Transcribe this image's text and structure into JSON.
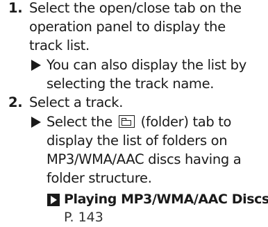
{
  "steps": [
    {
      "number": "1.",
      "lines": [
        "Select the open/close tab on the",
        "operation panel to display the",
        "track list."
      ],
      "notes": [
        {
          "lines": [
            "You can also display the list by",
            "selecting the track name."
          ]
        }
      ]
    },
    {
      "number": "2.",
      "lines": [
        "Select a track."
      ],
      "notes": [
        {
          "lines": [
            "Select the",
            "(folder) tab to",
            "display the list of folders on",
            "MP3/WMA/AAC discs having a",
            "folder structure."
          ]
        }
      ],
      "reference": {
        "title": "Playing MP3/WMA/AAC Discs",
        "page": "P. 143"
      }
    }
  ]
}
